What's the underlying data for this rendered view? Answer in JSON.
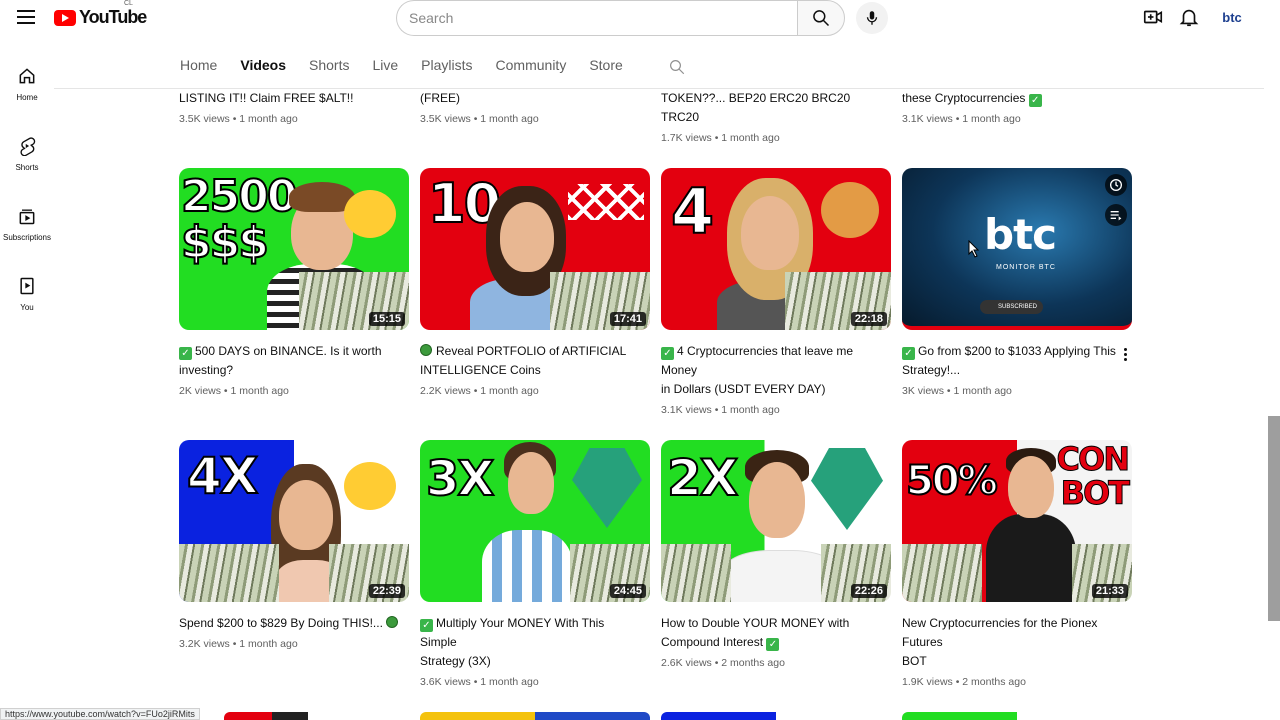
{
  "header": {
    "logo_text": "YouTube",
    "country_code": "CL",
    "search_placeholder": "Search",
    "avatar_text": "btc"
  },
  "sidebar": {
    "items": [
      {
        "label": "Home",
        "icon": "home-icon"
      },
      {
        "label": "Shorts",
        "icon": "shorts-icon"
      },
      {
        "label": "Subscriptions",
        "icon": "subscriptions-icon"
      },
      {
        "label": "You",
        "icon": "you-icon"
      }
    ]
  },
  "tabs": [
    {
      "label": "Home",
      "active": false
    },
    {
      "label": "Videos",
      "active": true
    },
    {
      "label": "Shorts",
      "active": false
    },
    {
      "label": "Live",
      "active": false
    },
    {
      "label": "Playlists",
      "active": false
    },
    {
      "label": "Community",
      "active": false
    },
    {
      "label": "Store",
      "active": false
    }
  ],
  "previous_row": [
    {
      "title_tail": "LISTING IT!! Claim FREE $ALT!!",
      "meta": "3.5K views • 1 month ago"
    },
    {
      "title_tail": "(FREE)",
      "meta": "3.5K views • 1 month ago"
    },
    {
      "title_tail": "TOKEN??... BEP20 ERC20 BRC20 TRC20",
      "meta": "1.7K views • 1 month ago"
    },
    {
      "title_tail": "these Cryptocurrencies",
      "meta": "3.1K views • 1 month ago"
    }
  ],
  "videos": [
    {
      "thumb_text": "2500\n$$$",
      "duration": "15:15",
      "title_line1": "500 DAYS on BINANCE. Is it worth",
      "title_line2": "investing?",
      "meta": "2K views • 1 month ago",
      "prefix": "check"
    },
    {
      "thumb_text": "10",
      "duration": "17:41",
      "title_line1": "Reveal PORTFOLIO of ARTIFICIAL",
      "title_line2": "INTELLIGENCE Coins",
      "meta": "2.2K views • 1 month ago",
      "prefix": "coin"
    },
    {
      "thumb_text": "4",
      "duration": "22:18",
      "title_line1": "4 Cryptocurrencies that leave me Money",
      "title_line2": "in Dollars (USDT EVERY DAY)",
      "meta": "3.1K views • 1 month ago",
      "prefix": "check"
    },
    {
      "thumb_text": "btc",
      "thumb_sub": "MONITOR BTC",
      "thumb_badge": "SUBSCRIBED",
      "duration": "",
      "title_line1": "Go from $200 to $1033 Applying This",
      "title_line2": "Strategy!...",
      "meta": "3K views • 1 month ago",
      "prefix": "check"
    },
    {
      "thumb_text": "4X",
      "duration": "22:39",
      "title_line1": "Spend $200 to $829 By Doing THIS!...",
      "title_line2": "",
      "meta": "3.2K views • 1 month ago",
      "prefix": "none",
      "suffix": "coin"
    },
    {
      "thumb_text": "3X",
      "duration": "24:45",
      "title_line1": "Multiply Your MONEY With This Simple",
      "title_line2": "Strategy (3X)",
      "meta": "3.6K views • 1 month ago",
      "prefix": "check"
    },
    {
      "thumb_text": "2X",
      "duration": "22:26",
      "title_line1": "How to Double YOUR MONEY with",
      "title_line2": "Compound Interest",
      "meta": "2.6K views • 2 months ago",
      "prefix": "none",
      "suffix": "check"
    },
    {
      "thumb_text": "50%",
      "thumb_text2": "CON\nBOT",
      "duration": "21:33",
      "title_line1": "New Cryptocurrencies for the Pionex Futures",
      "title_line2": "BOT",
      "meta": "1.9K views • 2 months ago",
      "prefix": "none"
    }
  ],
  "status_bar_url": "https://www.youtube.com/watch?v=FUo2jiRMits",
  "colors": {
    "red": "#e3000f",
    "green": "#22dd22",
    "blue": "#0a22e0",
    "tether": "#26a17b",
    "brand": "#ff0000"
  }
}
